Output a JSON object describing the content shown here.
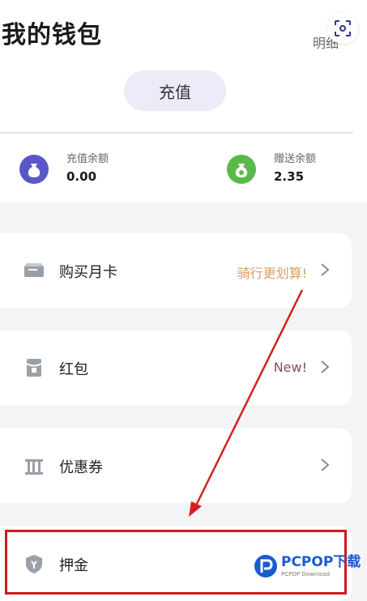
{
  "header": {
    "title": "我的钱包",
    "details_link": "明细"
  },
  "actions": {
    "recharge": "充值"
  },
  "balances": {
    "recharge": {
      "label": "充值余额",
      "value": "0.00"
    },
    "gift": {
      "label": "赠送余额",
      "value": "2.35"
    }
  },
  "menu": {
    "monthly_card": {
      "label": "购买月卡",
      "tag": "骑行更划算!"
    },
    "red_packet": {
      "label": "红包",
      "tag": "New!"
    },
    "coupon": {
      "label": "优惠券"
    },
    "deposit": {
      "label": "押金"
    }
  },
  "watermark": {
    "main": "PCPOP下载",
    "sub": "PCPOP Download"
  },
  "colors": {
    "tag_orange": "#d7a066",
    "tag_purple": "#8a4a6a",
    "highlight_red": "#c81c1c",
    "recharge_bg": "#ececf8",
    "icon_purple": "#5957c8",
    "icon_green": "#5db84a"
  }
}
